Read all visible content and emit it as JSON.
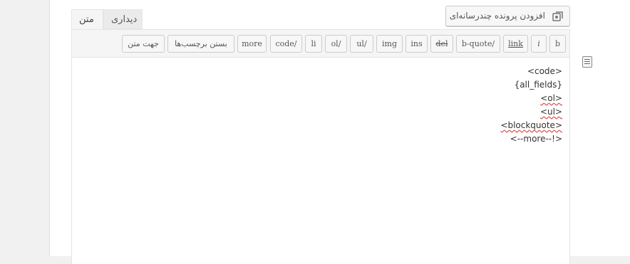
{
  "editor": {
    "tabs": [
      {
        "label": "دیداری",
        "active": false
      },
      {
        "label": "متن",
        "active": true
      }
    ],
    "add_media_label": "افزودن پرونده چندرسانه‌ای",
    "toolbar": {
      "buttons": [
        "b",
        "i",
        "link",
        "b-quote/",
        "del",
        "ins",
        "img",
        "ul/",
        "ol/",
        "li",
        "code/",
        "more",
        "بستن برچسب‌ها",
        "جهت متن"
      ]
    },
    "content_lines": [
      "<code>",
      "{all_fields}",
      "<ol>",
      "<ul>",
      "<blockquote>",
      "<--more--!>"
    ]
  },
  "colors": {
    "page_bg": "#f1f1f1",
    "toolbar_bg": "#f5f5f5",
    "border": "#e5e5e5",
    "button_bg": "#f7f7f7",
    "text": "#555555"
  },
  "icons": {
    "add_media": "media-add-icon",
    "side": "screen-options-icon"
  }
}
